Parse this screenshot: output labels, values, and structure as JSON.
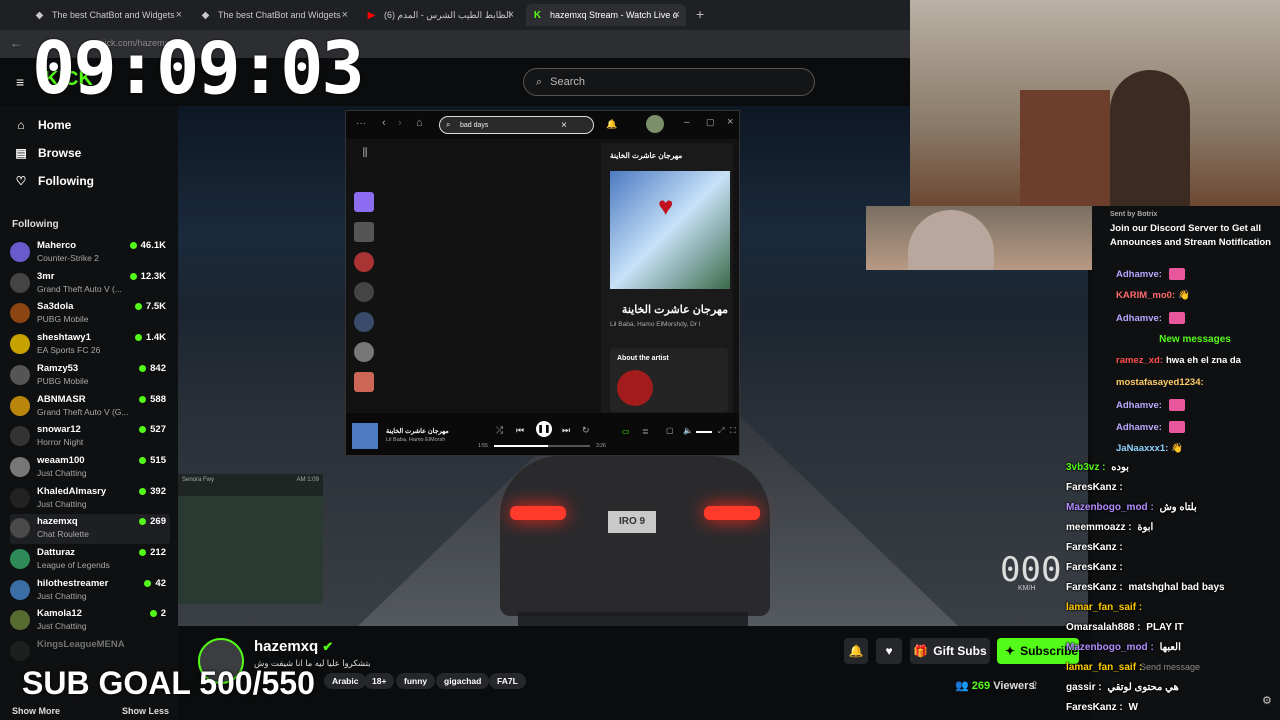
{
  "browser": {
    "tabs": [
      {
        "label": "The best ChatBot and Widgets",
        "x": 0
      },
      {
        "label": "The best ChatBot and Widgets",
        "x": 0
      },
      {
        "label": "الظابط الطيب الشرس - المدم (6)",
        "x": 0
      },
      {
        "label": "hazemxq Stream - Watch Live o",
        "x": 0
      }
    ],
    "url": "kick.com/hazemxq"
  },
  "clock": "09:09:03",
  "header": {
    "search_placeholder": "Search"
  },
  "sidebar": {
    "nav": [
      {
        "label": "Home",
        "icon": "home-icon"
      },
      {
        "label": "Browse",
        "icon": "browse-icon"
      },
      {
        "label": "Following",
        "icon": "heart-icon"
      }
    ],
    "following_title": "Following",
    "channels": [
      {
        "name": "Maherco",
        "category": "Counter-Strike 2",
        "viewers": "46.1K",
        "color": "#6a5acd"
      },
      {
        "name": "3mr",
        "category": "Grand Theft Auto V (...",
        "viewers": "12.3K",
        "color": "#444"
      },
      {
        "name": "Sa3dola",
        "category": "PUBG Mobile",
        "viewers": "7.5K",
        "color": "#8b4513"
      },
      {
        "name": "sheshtawy1",
        "category": "EA Sports FC 26",
        "viewers": "1.4K",
        "color": "#c8a200"
      },
      {
        "name": "Ramzy53",
        "category": "PUBG Mobile",
        "viewers": "842",
        "color": "#555"
      },
      {
        "name": "ABNMASR",
        "category": "Grand Theft Auto V (G...",
        "viewers": "588",
        "color": "#b8860b"
      },
      {
        "name": "snowar12",
        "category": "Horror Night",
        "viewers": "527",
        "color": "#333"
      },
      {
        "name": "weaam100",
        "category": "Just Chatting",
        "viewers": "515",
        "color": "#777"
      },
      {
        "name": "KhaledAlmasry",
        "category": "Just Chatting",
        "viewers": "392",
        "color": "#222"
      },
      {
        "name": "hazemxq",
        "category": "Chat Roulette",
        "viewers": "269",
        "color": "#4a4a4a"
      },
      {
        "name": "Datturaz",
        "category": "League of Legends",
        "viewers": "212",
        "color": "#2e8b57"
      },
      {
        "name": "hilothestreamer",
        "category": "Just Chatting",
        "viewers": "42",
        "color": "#3a6ea5"
      },
      {
        "name": "Kamola12",
        "category": "Just Chatting",
        "viewers": "2",
        "color": "#556b2f"
      },
      {
        "name": "KingsLeagueMENA",
        "category": "",
        "viewers": "",
        "color": "#333"
      }
    ],
    "show_more": "Show More",
    "show_less": "Show Less"
  },
  "spotify": {
    "search_value": "bad days",
    "panel_title": "مهرجان عاشرت الخاينة",
    "song_title": "مهرجان عاشرت الخاينة",
    "artists": "Lil Baba, Hamo ElMorshdy, Dr I",
    "about_artist": "About the artist",
    "player_title": "مهرجان عاشرت الخاينة",
    "player_artist": "Lil Baba, Hamo ElMorsh",
    "time_elapsed": "1:55",
    "time_total": "3:26"
  },
  "game": {
    "plate": "IRO 9",
    "minimap_location": "Senora Fwy",
    "minimap_time": "AM 1:09",
    "speed": "000",
    "speed_unit": "KM/H"
  },
  "channel": {
    "name": "hazemxq",
    "bio": "بتشكروا عليا ليه ما انا شيفت وش",
    "tags": [
      "Arabic",
      "18+",
      "funny",
      "gigachad",
      "FA7L"
    ],
    "viewers_count": "269",
    "viewers_label": "Viewers",
    "gift_subs": "Gift Subs",
    "subscribe": "Subscribe"
  },
  "overlay": {
    "sub_goal": "SUB GOAL 500/550"
  },
  "chat": {
    "sent_by": "Sent by  Botrix",
    "pinned": "Join our Discord Server to Get all Announces and Stream Notification",
    "new_messages": "New messages",
    "messages": [
      {
        "user": "Adhamve:",
        "text": "",
        "color": "#b8a6ff",
        "emote": true
      },
      {
        "user": "KARIM_mo0:",
        "text": "👋",
        "color": "#ff6a6a",
        "emote": false
      },
      {
        "user": "Adhamve:",
        "text": "",
        "color": "#b8a6ff",
        "emote": true
      },
      {
        "user": "ramez_xd:",
        "text": "hwa eh el zna da",
        "color": "#ff4d4d",
        "emote": false
      },
      {
        "user": "mostafasayed1234:",
        "text": "",
        "color": "#ffcc66",
        "emote": false
      },
      {
        "user": "Adhamve:",
        "text": "",
        "color": "#b8a6ff",
        "emote": true
      },
      {
        "user": "Adhamve:",
        "text": "",
        "color": "#b8a6ff",
        "emote": true
      },
      {
        "user": "JaNaaxxx1:",
        "text": "👋",
        "color": "#8fd3ff",
        "emote": false
      }
    ],
    "overlay_msgs": [
      {
        "user": "3vb3vz :",
        "text": "بوده",
        "color": "#53fc18"
      },
      {
        "user": "FaresKanz :",
        "text": "",
        "color": "#ffffff"
      },
      {
        "user": "Mazenbogo_mod :",
        "text": "بلتاه وش",
        "color": "#b28cff"
      },
      {
        "user": "meemmoazz :",
        "text": "ابوة",
        "color": "#ffffff"
      },
      {
        "user": "FaresKanz :",
        "text": "",
        "color": "#ffffff"
      },
      {
        "user": "FaresKanz :",
        "text": "",
        "color": "#ffffff"
      },
      {
        "user": "FaresKanz :",
        "text": "matshghal bad bays",
        "color": "#ffffff"
      },
      {
        "user": "lamar_fan_saif :",
        "text": "",
        "color": "#ffcc00"
      },
      {
        "user": "Omarsalah888 :",
        "text": "PLAY IT",
        "color": "#ffffff"
      },
      {
        "user": "Mazenbogo_mod :",
        "text": "العبها",
        "color": "#b28cff"
      },
      {
        "user": "lamar_fan_saif :",
        "text": "",
        "color": "#ffcc00"
      },
      {
        "user": "gassir :",
        "text": "هي محتوى لوتقي",
        "color": "#ffffff"
      },
      {
        "user": "FaresKanz :",
        "text": "W",
        "color": "#ffffff"
      }
    ],
    "send_placeholder": "Send message"
  }
}
